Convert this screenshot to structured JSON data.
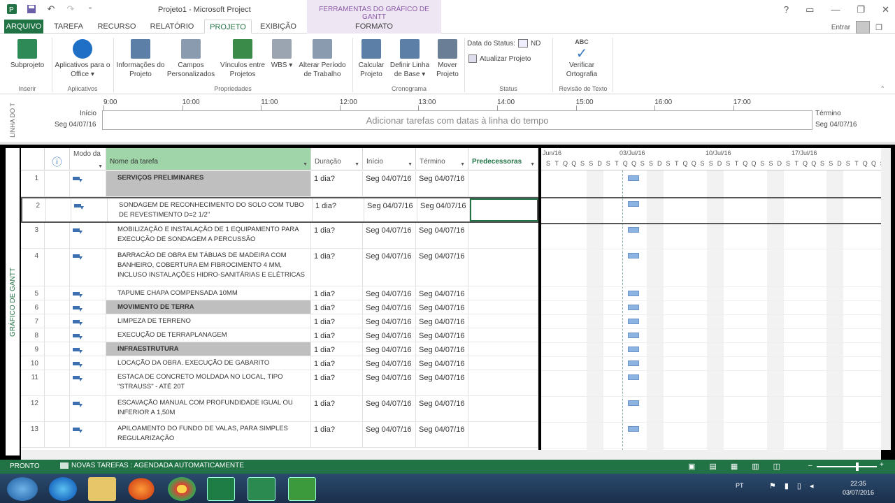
{
  "window": {
    "title": "Projeto1 - Microsoft Project",
    "context_header": "FERRAMENTAS DO GRÁFICO DE GANTT"
  },
  "window_controls": [
    "?",
    "▭",
    "—",
    "❐",
    "✕"
  ],
  "tabs": [
    {
      "label": "ARQUIVO"
    },
    {
      "label": "TAREFA"
    },
    {
      "label": "RECURSO"
    },
    {
      "label": "RELATÓRIO"
    },
    {
      "label": "PROJETO"
    },
    {
      "label": "EXIBIÇÃO"
    },
    {
      "label": "FORMATO"
    }
  ],
  "user": {
    "label": "Entrar"
  },
  "ribbon": {
    "buttons": [
      {
        "label": "Subprojeto",
        "color": "#2e8b57"
      },
      {
        "label": "Aplicativos para o Office ▾",
        "color": "#1e6fc5"
      },
      {
        "label": "Informações do Projeto",
        "color": "#5b7fa6"
      },
      {
        "label": "Campos Personalizados",
        "color": "#8a9bb0"
      },
      {
        "label": "Vínculos entre Projetos",
        "color": "#3a8a4a"
      },
      {
        "label": "WBS ▾",
        "color": "#9aa5b1"
      },
      {
        "label": "Alterar Período de Trabalho",
        "color": "#8a9bb0"
      },
      {
        "label": "Calcular Projeto",
        "color": "#5b7fa6"
      },
      {
        "label": "Definir Linha de Base ▾",
        "color": "#5b7fa6"
      },
      {
        "label": "Mover Projeto",
        "color": "#6a7f95"
      },
      {
        "label": "Verificar Ortografia",
        "color": "#3c7bbf"
      }
    ],
    "status_date_label": "Data do Status:",
    "status_date_value": "ND",
    "update_project": "Atualizar Projeto",
    "abc_label": "ABC",
    "groups": [
      "Inserir",
      "Aplicativos",
      "Propriedades",
      "Cronograma",
      "Status",
      "Revisão de Texto"
    ]
  },
  "timeline": {
    "side_label": "LINHA DO T",
    "start_label": "Início",
    "start_date": "Seg 04/07/16",
    "end_label": "Término",
    "end_date": "Seg 04/07/16",
    "placeholder": "Adicionar tarefas com datas à linha do tempo",
    "ticks": [
      "9:00",
      "10:00",
      "11:00",
      "12:00",
      "13:00",
      "14:00",
      "15:00",
      "16:00",
      "17:00"
    ]
  },
  "view_label": "GRÁFICO DE GANTT",
  "grid": {
    "columns": [
      {
        "label": ""
      },
      {
        "label": "ⓘ"
      },
      {
        "label": "Modo da"
      },
      {
        "label": "Nome da tarefa"
      },
      {
        "label": "Duração"
      },
      {
        "label": "Início"
      },
      {
        "label": "Término"
      },
      {
        "label": "Predecessoras"
      }
    ],
    "rows": [
      {
        "id": "1",
        "name": "SERVIÇOS PRELIMINARES",
        "summary": true,
        "duration": "1 dia?",
        "start": "Seg 04/07/16",
        "finish": "Seg 04/07/16"
      },
      {
        "id": "2",
        "name": "SONDAGEM DE RECONHECIMENTO DO SOLO COM TUBO DE REVESTIMENTO D=2 1/2\"",
        "summary": false,
        "duration": "1 dia?",
        "start": "Seg 04/07/16",
        "finish": "Seg 04/07/16"
      },
      {
        "id": "3",
        "name": "MOBILIZAÇÃO E INSTALAÇÃO DE 1 EQUIPAMENTO PARA EXECUÇÃO DE SONDAGEM A PERCUSSÃO",
        "summary": false,
        "duration": "1 dia?",
        "start": "Seg 04/07/16",
        "finish": "Seg 04/07/16"
      },
      {
        "id": "4",
        "name": "BARRACÃO DE OBRA EM TÁBUAS DE MADEIRA COM BANHEIRO, COBERTURA EM FIBROCIMENTO 4 MM, INCLUSO INSTALAÇÕES HIDRO-SANITÁRIAS E ELÉTRICAS",
        "summary": false,
        "duration": "1 dia?",
        "start": "Seg 04/07/16",
        "finish": "Seg 04/07/16"
      },
      {
        "id": "5",
        "name": "TAPUME CHAPA COMPENSADA 10MM",
        "summary": false,
        "duration": "1 dia?",
        "start": "Seg 04/07/16",
        "finish": "Seg 04/07/16"
      },
      {
        "id": "6",
        "name": "MOVIMENTO DE TERRA",
        "summary": true,
        "duration": "1 dia?",
        "start": "Seg 04/07/16",
        "finish": "Seg 04/07/16"
      },
      {
        "id": "7",
        "name": "LIMPEZA DE TERRENO",
        "summary": false,
        "duration": "1 dia?",
        "start": "Seg 04/07/16",
        "finish": "Seg 04/07/16"
      },
      {
        "id": "8",
        "name": "EXECUÇÃO DE TERRAPLANAGEM",
        "summary": false,
        "duration": "1 dia?",
        "start": "Seg 04/07/16",
        "finish": "Seg 04/07/16"
      },
      {
        "id": "9",
        "name": "INFRAESTRUTURA",
        "summary": true,
        "duration": "1 dia?",
        "start": "Seg 04/07/16",
        "finish": "Seg 04/07/16"
      },
      {
        "id": "10",
        "name": "LOCAÇÃO DA OBRA. EXECUÇÃO DE GABARITO",
        "summary": false,
        "duration": "1 dia?",
        "start": "Seg 04/07/16",
        "finish": "Seg 04/07/16"
      },
      {
        "id": "11",
        "name": "ESTACA DE CONCRETO MOLDADA NO LOCAL, TIPO \"STRAUSS\" - ATÉ 20T",
        "summary": false,
        "duration": "1 dia?",
        "start": "Seg 04/07/16",
        "finish": "Seg 04/07/16"
      },
      {
        "id": "12",
        "name": "ESCAVAÇÃO MANUAL COM PROFUNDIDADE IGUAL OU INFERIOR A 1,50M",
        "summary": false,
        "duration": "1 dia?",
        "start": "Seg 04/07/16",
        "finish": "Seg 04/07/16"
      },
      {
        "id": "13",
        "name": "APILOAMENTO DO FUNDO DE VALAS, PARA SIMPLES REGULARIZAÇÃO",
        "summary": false,
        "duration": "1 dia?",
        "start": "Seg 04/07/16",
        "finish": "Seg 04/07/16"
      }
    ]
  },
  "gantt": {
    "weeks": [
      "Jun/16",
      "03/Jul/16",
      "10/Jul/16",
      "17/Jul/16"
    ],
    "days": [
      "S",
      "T",
      "Q",
      "Q",
      "S",
      "S",
      "D",
      "S",
      "T",
      "Q",
      "Q",
      "S",
      "S",
      "D",
      "S",
      "T",
      "Q",
      "Q",
      "S",
      "S",
      "D",
      "S",
      "T",
      "Q",
      "Q",
      "S",
      "S",
      "D",
      "S",
      "T",
      "Q",
      "Q",
      "S",
      "S",
      "D",
      "S",
      "T",
      "Q",
      "Q",
      "S",
      "S"
    ]
  },
  "status": {
    "ready": "PRONTO",
    "new_tasks": "NOVAS TAREFAS : AGENDADA AUTOMATICAMENTE"
  },
  "taskbar": {
    "lang": "PT",
    "time": "22:35",
    "date": "03/07/2016"
  }
}
